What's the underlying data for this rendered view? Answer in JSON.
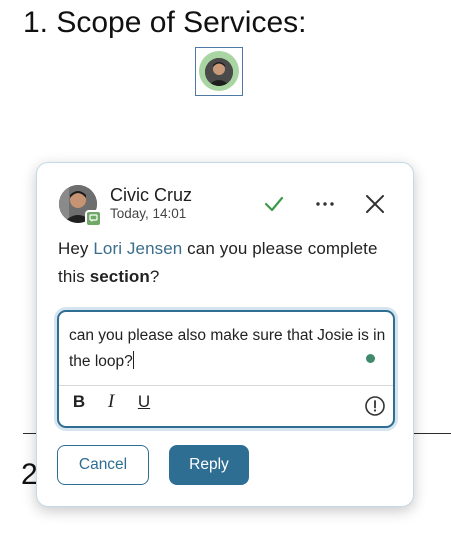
{
  "document": {
    "heading": "1. Scope of Services:",
    "next_heading": "2"
  },
  "comment": {
    "author_name": "Civic Cruz",
    "timestamp": "Today, 14:01",
    "body_prefix": "Hey ",
    "mention": "Lori Jensen",
    "body_middle": " can you please complete this ",
    "body_bold": "section",
    "body_suffix": "?",
    "resolve_icon": "check-icon",
    "more_icon": "more-icon",
    "close_icon": "close-icon"
  },
  "reply": {
    "text": "can you please also make sure that Josie is in the loop?",
    "toolbar": {
      "bold": "B",
      "italic": "I",
      "underline": "U",
      "info_icon": "info-icon"
    },
    "cancel_label": "Cancel",
    "submit_label": "Reply"
  },
  "colors": {
    "accent": "#2f6e93",
    "mention": "#3b6d8c",
    "resolve_check": "#3e9a4a",
    "presence": "#3e8a6b",
    "badge": "#6fa867"
  }
}
